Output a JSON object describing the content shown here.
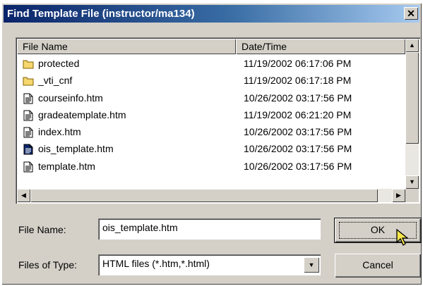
{
  "window": {
    "title": "Find Template File (instructor/ma134)",
    "close_label": "✕"
  },
  "list": {
    "columns": [
      "File Name",
      "Date/Time"
    ],
    "items": [
      {
        "name": "protected",
        "date": "11/19/2002 06:17:06 PM",
        "icon": "folder-icon"
      },
      {
        "name": "_vti_cnf",
        "date": "11/19/2002 06:17:18 PM",
        "icon": "folder-icon"
      },
      {
        "name": "courseinfo.htm",
        "date": "10/26/2002 03:17:56 PM",
        "icon": "document-icon"
      },
      {
        "name": "gradeatemplate.htm",
        "date": "11/19/2002 06:21:20 PM",
        "icon": "document-icon"
      },
      {
        "name": "index.htm",
        "date": "10/26/2002 03:17:56 PM",
        "icon": "document-icon"
      },
      {
        "name": "ois_template.htm",
        "date": "10/26/2002 03:17:56 PM",
        "icon": "document-icon",
        "selected_icon": true
      },
      {
        "name": "template.htm",
        "date": "10/26/2002 03:17:56 PM",
        "icon": "document-icon"
      }
    ]
  },
  "form": {
    "file_name_label": "File Name:",
    "file_name_value": "ois_template.htm",
    "file_type_label": "Files of Type:",
    "file_type_value": "HTML files (*.htm,*.html)"
  },
  "buttons": {
    "ok": "OK",
    "cancel": "Cancel"
  },
  "colors": {
    "title_start": "#0a246a",
    "title_end": "#a6caf0",
    "face": "#d4d0c8"
  }
}
